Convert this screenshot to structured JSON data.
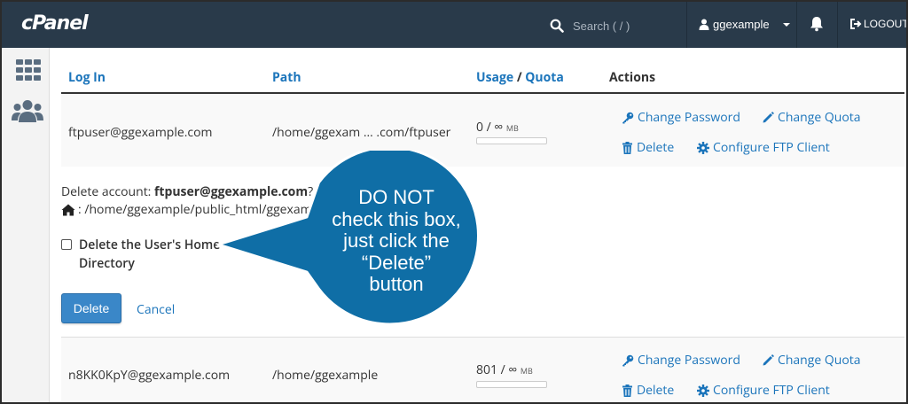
{
  "topbar": {
    "logo": "cPanel",
    "search_placeholder": "Search ( / )",
    "username": "ggexample",
    "logout_label": "LOGOUT"
  },
  "sidebar": {
    "items": [
      {
        "icon": "grid-icon"
      },
      {
        "icon": "users-icon"
      }
    ]
  },
  "table": {
    "headers": {
      "login": "Log In",
      "path": "Path",
      "usage": "Usage",
      "slash": "/",
      "quota": "Quota",
      "actions": "Actions"
    },
    "rows": [
      {
        "login": "ftpuser@ggexample.com",
        "path": "/home/ggexam … .com/ftpuser",
        "usage": "0 / ∞",
        "unit": "MB"
      },
      {
        "login": "n8KK0KpY@ggexample.com",
        "path": "/home/ggexample",
        "usage": "801 / ∞",
        "unit": "MB"
      }
    ],
    "actions": {
      "change_password": "Change Password",
      "change_quota": "Change Quota",
      "delete": "Delete",
      "configure": "Configure FTP Client"
    }
  },
  "delete_panel": {
    "prompt": "Delete account: ",
    "account": "ftpuser@ggexample.com",
    "prompt_end": "?",
    "path": ": /home/ggexample/public_html/ggexamp",
    "checkbox_label": "Delete the User's Home Directory",
    "checkbox_checked": false,
    "delete_button": "Delete",
    "cancel_link": "Cancel"
  },
  "callout": {
    "color": "#0f6ea6",
    "lines": [
      "DO NOT",
      "check this box,",
      "just click the",
      "“Delete”",
      "button"
    ]
  },
  "colors": {
    "topbar": "#293a4a",
    "link": "#1c75bb",
    "button": "#3a87c8"
  }
}
